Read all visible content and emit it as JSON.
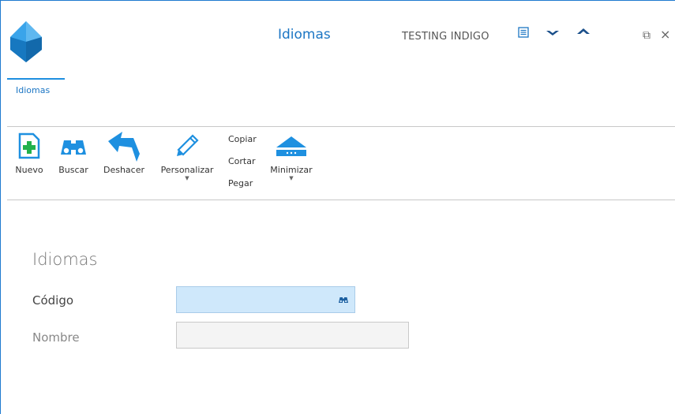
{
  "window": {
    "title": "Idiomas",
    "company": "TESTING INDIGO",
    "controls": {
      "restore": "⧉",
      "close": "×"
    }
  },
  "ribbon": {
    "tabs": [
      {
        "label": "Idiomas",
        "active": true
      }
    ],
    "buttons": {
      "nuevo": "Nuevo",
      "buscar": "Buscar",
      "deshacer": "Deshacer",
      "personalizar": "Personalizar",
      "minimizar": "Minimizar"
    },
    "clipboard": {
      "copiar": "Copiar",
      "cortar": "Cortar",
      "pegar": "Pegar"
    },
    "dropdown_arrow": "▼"
  },
  "form": {
    "section_title": "Idiomas",
    "fields": {
      "codigo": {
        "label": "Código",
        "value": ""
      },
      "nombre": {
        "label": "Nombre",
        "value": ""
      }
    }
  },
  "colors": {
    "accent": "#1c76c4",
    "icon_blue": "#1e90e0",
    "nuevo_green": "#22b14c",
    "codigo_bg": "#cfe8fb"
  }
}
